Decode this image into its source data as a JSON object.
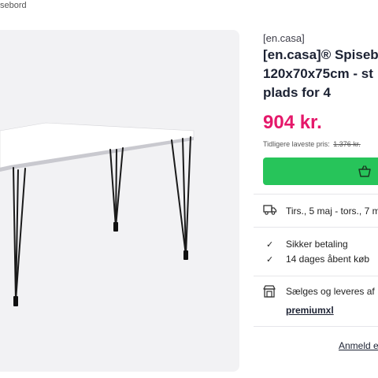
{
  "breadcrumb": {
    "current": "sebord"
  },
  "product": {
    "brand": "[en.casa]",
    "title_lines": [
      "[en.casa]® Spiseb",
      "120x70x75cm - st",
      "plads for 4"
    ],
    "price": "904 kr.",
    "previous_price_label": "Tidligere laveste pris:",
    "previous_price_value": "1.376 kr."
  },
  "cart_button": {
    "icon": "shopping-basket-icon",
    "color": "#27c45a"
  },
  "delivery": {
    "icon": "truck-icon",
    "text": "Tirs., 5 maj - tors., 7 m"
  },
  "benefits": [
    {
      "icon": "check-icon",
      "text": "Sikker betaling"
    },
    {
      "icon": "check-icon",
      "text": "14 dages åbent køb"
    }
  ],
  "seller": {
    "icon": "store-icon",
    "text": "Sælges og leveres af",
    "link": "premiumxl"
  },
  "review": {
    "link": "Anmeld e"
  },
  "colors": {
    "price": "#e5186a",
    "accent": "#27c45a"
  }
}
